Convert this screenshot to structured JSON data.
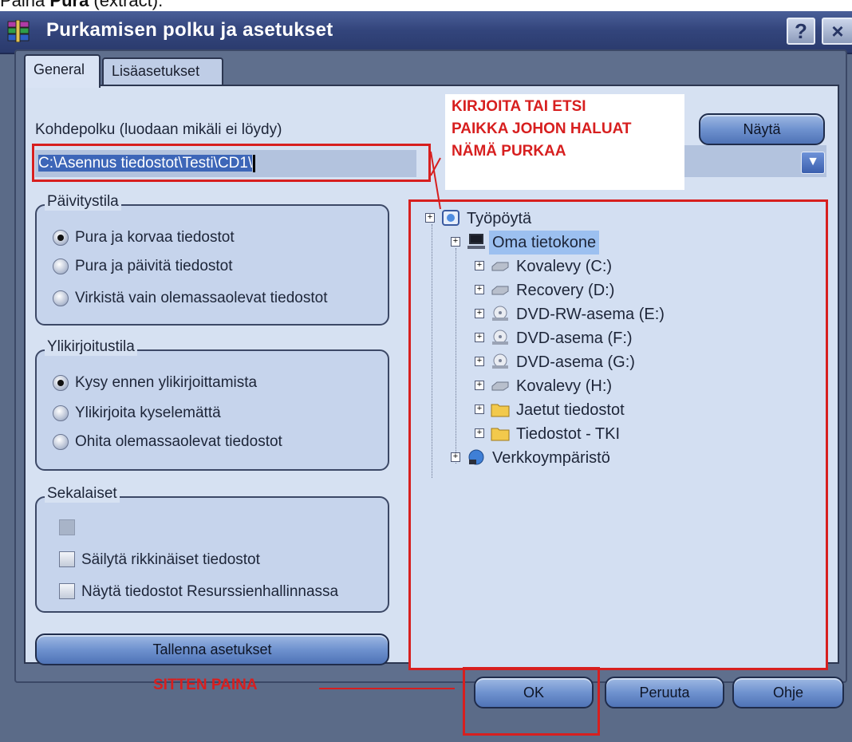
{
  "caption": {
    "prefix": "Paina ",
    "bold": "Pura",
    "suffix": " (extract)."
  },
  "window": {
    "title": "Purkamisen polku ja asetukset",
    "help": "?",
    "close": "×"
  },
  "tabs": [
    {
      "label": "General"
    },
    {
      "label": "Lisäasetukset"
    }
  ],
  "destination": {
    "label": "Kohdepolku (luodaan mikäli ei löydy)",
    "value": "C:\\Asennus tiedostot\\Testi\\CD1\\",
    "show_button": "Näytä"
  },
  "update_mode": {
    "title": "Päivitystila",
    "options": [
      {
        "label": "Pura ja korvaa tiedostot",
        "selected": true
      },
      {
        "label": "Pura ja päivitä tiedostot",
        "selected": false
      },
      {
        "label": "Virkistä vain olemassaolevat tiedostot",
        "selected": false
      }
    ]
  },
  "overwrite_mode": {
    "title": "Ylikirjoitustila",
    "options": [
      {
        "label": "Kysy ennen ylikirjoittamista",
        "selected": true
      },
      {
        "label": "Ylikirjoita kyselemättä",
        "selected": false
      },
      {
        "label": "Ohita olemassaolevat tiedostot",
        "selected": false
      }
    ]
  },
  "misc": {
    "title": "Sekalaiset",
    "options": [
      {
        "label": "",
        "checked": false,
        "disabled": true
      },
      {
        "label": "Säilytä rikkinäiset tiedostot",
        "checked": false,
        "disabled": false
      },
      {
        "label": "Näytä tiedostot Resurssienhallinnassa",
        "checked": false,
        "disabled": false
      }
    ]
  },
  "save_settings": "Tallenna asetukset",
  "tree": {
    "root": "Työpöytä",
    "computer": "Oma tietokone",
    "drives": [
      {
        "label": "Kovalevy (C:)",
        "icon": "hard-drive-icon"
      },
      {
        "label": "Recovery (D:)",
        "icon": "hard-drive-icon"
      },
      {
        "label": "DVD-RW-asema (E:)",
        "icon": "dvd-drive-icon"
      },
      {
        "label": "DVD-asema (F:)",
        "icon": "dvd-drive-icon"
      },
      {
        "label": "DVD-asema (G:)",
        "icon": "dvd-drive-icon"
      },
      {
        "label": "Kovalevy (H:)",
        "icon": "hard-drive-icon"
      },
      {
        "label": "Jaetut tiedostot",
        "icon": "folder-icon"
      },
      {
        "label": "Tiedostot - TKI",
        "icon": "folder-icon"
      }
    ],
    "network": "Verkkoympäristö"
  },
  "annotation": {
    "lines": [
      "KIRJOITA TAI ETSI",
      "PAIKKA JOHON HALUAT",
      "NÄMÄ PURKAA"
    ],
    "footer": "SITTEN PAINA"
  },
  "footer": {
    "ok": "OK",
    "cancel": "Peruuta",
    "help": "Ohje"
  },
  "colors": {
    "annotation_red": "#d71f1f",
    "title_bar": "#33457c",
    "panel": "#d6e1f2"
  }
}
